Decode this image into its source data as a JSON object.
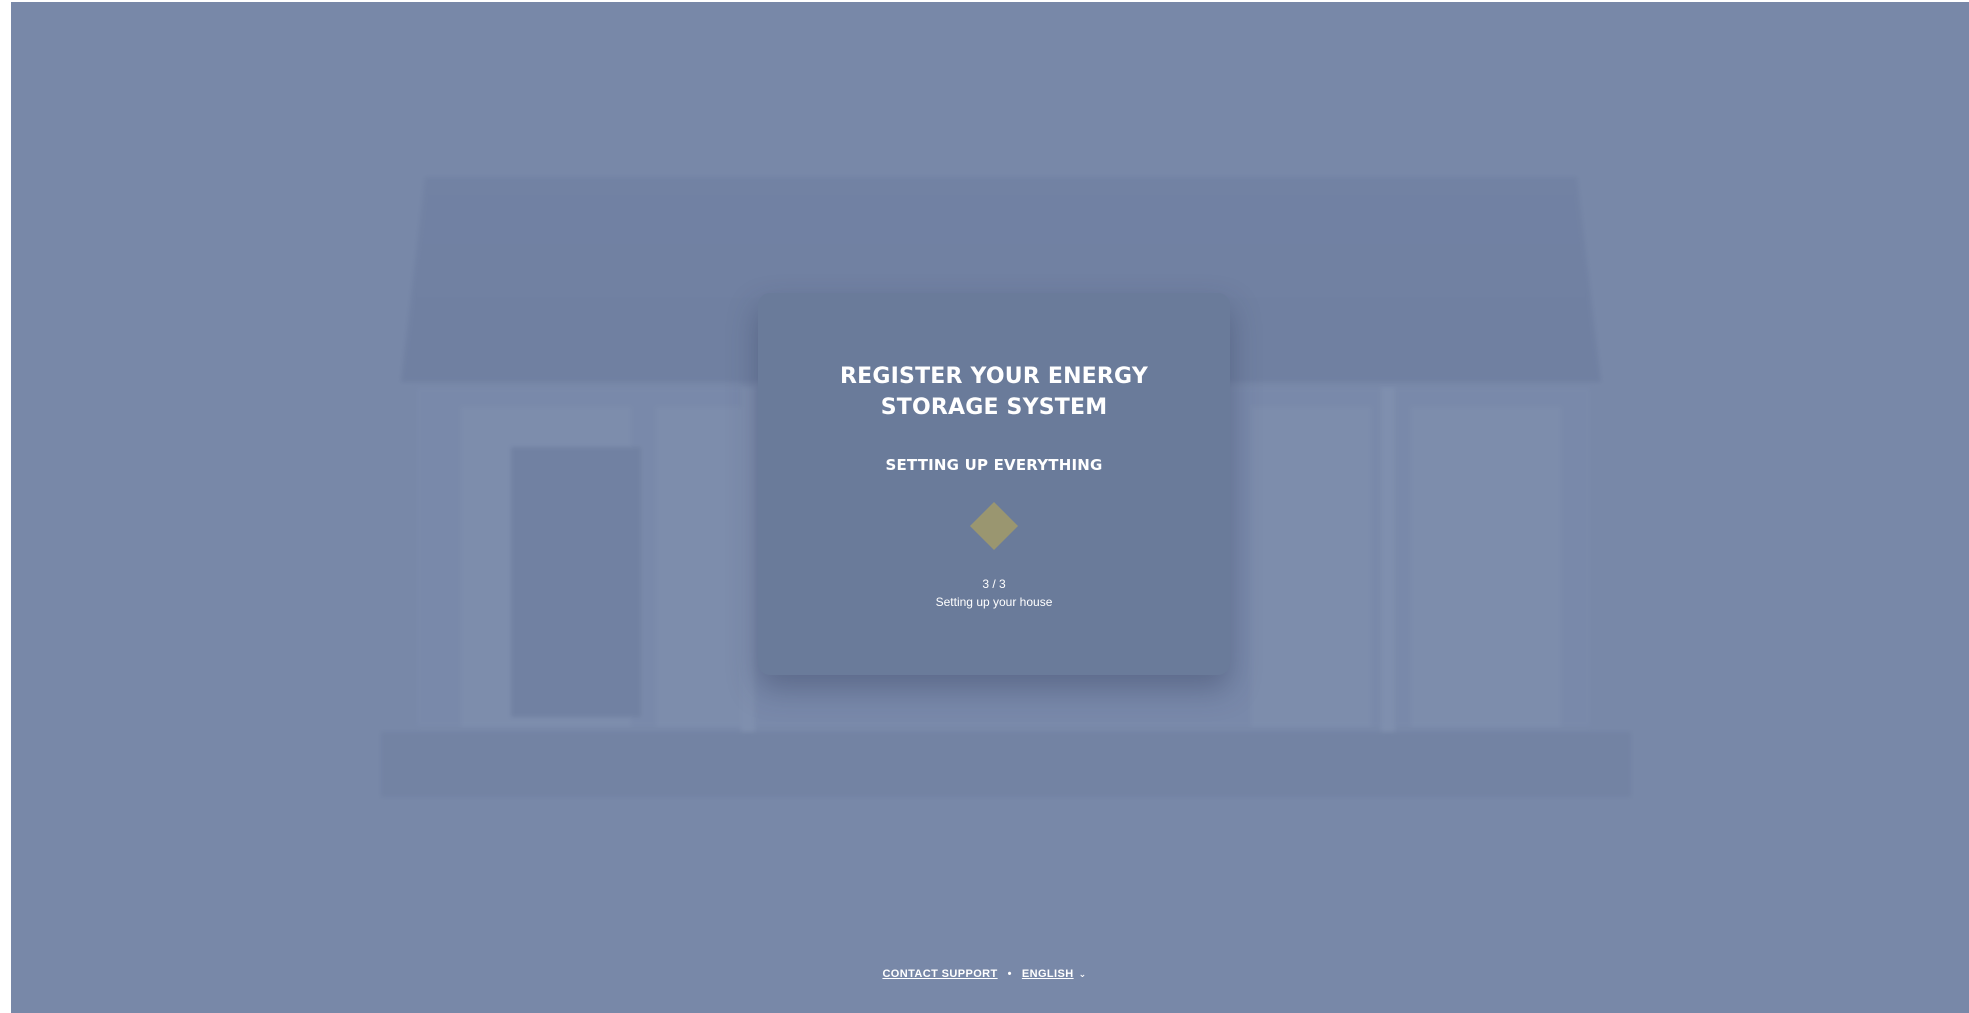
{
  "dialog": {
    "title": "REGISTER YOUR ENERGY STORAGE SYSTEM",
    "subtitle": "SETTING UP EVERYTHING",
    "loader_icon": "diamond-spinner",
    "loader_color": "#9a9670",
    "step_counter": "3 / 3",
    "step_description": "Setting up your house"
  },
  "footer": {
    "contact_support": "CONTACT SUPPORT",
    "separator": "•",
    "language": "ENGLISH",
    "language_icon": "chevron-down-icon"
  },
  "colors": {
    "background": "#7888a8",
    "card": "#6a7b9a",
    "text": "#ffffff"
  }
}
